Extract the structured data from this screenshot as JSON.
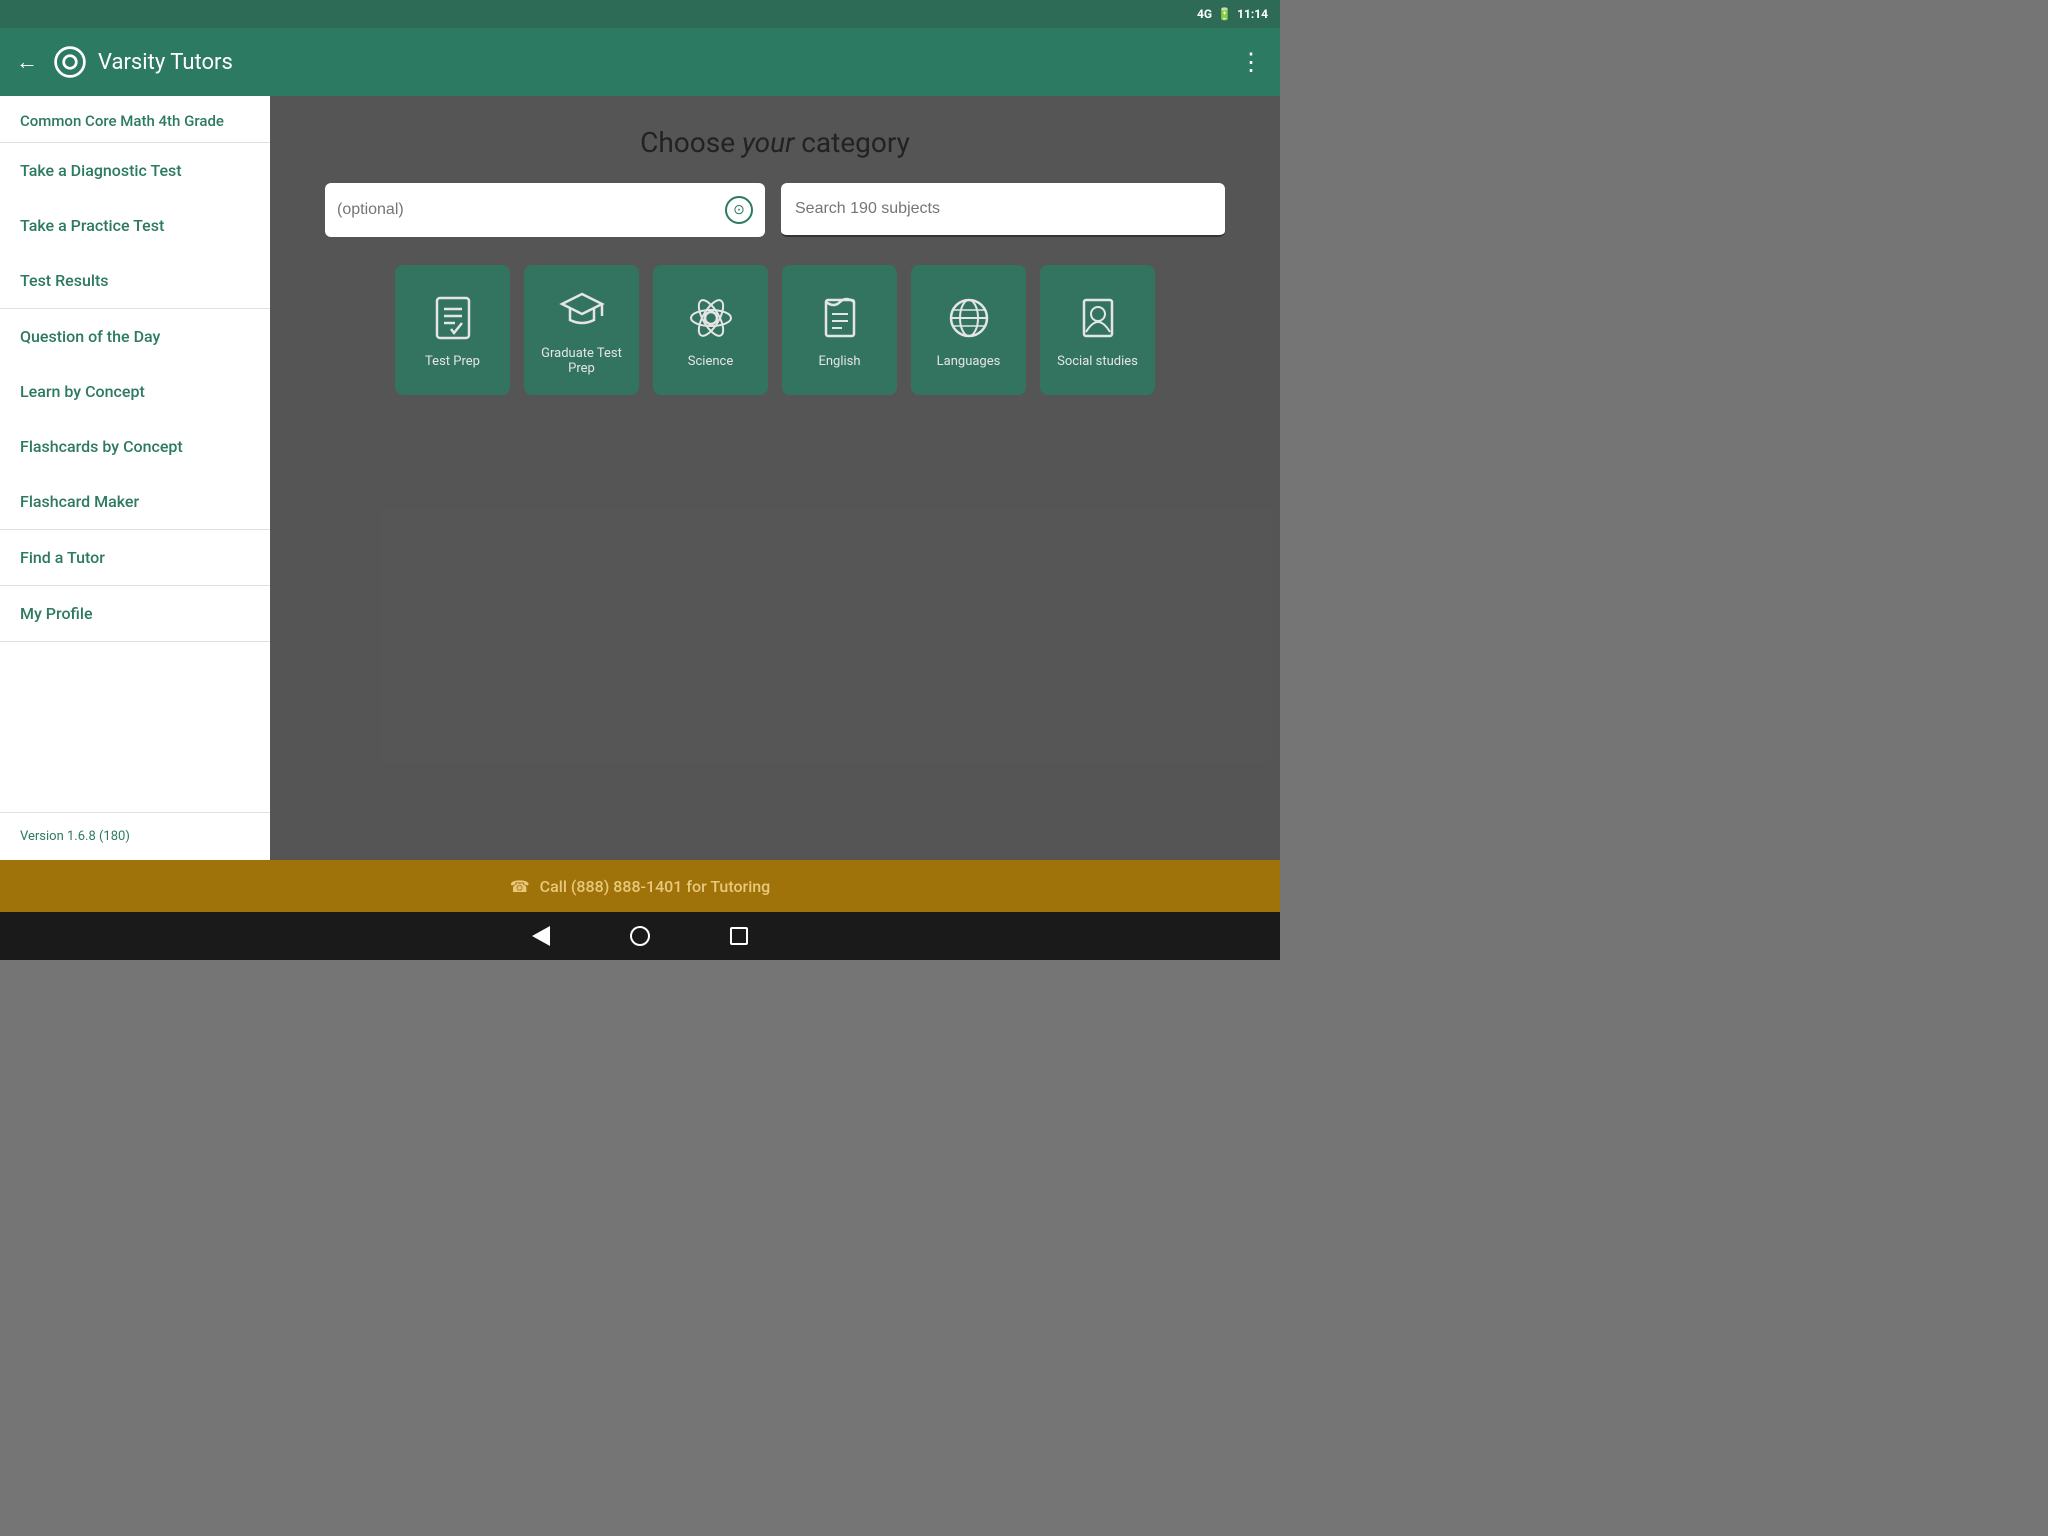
{
  "statusBar": {
    "signal": "4G",
    "time": "11:14"
  },
  "appBar": {
    "title": "Varsity Tutors",
    "backLabel": "←",
    "moreLabel": "⋮"
  },
  "sidebar": {
    "headerLabel": "Common Core Math 4th Grade",
    "items": [
      {
        "id": "diagnostic",
        "label": "Take a Diagnostic Test"
      },
      {
        "id": "practice",
        "label": "Take a Practice Test"
      },
      {
        "id": "results",
        "label": "Test Results"
      },
      {
        "id": "qotd",
        "label": "Question of the Day"
      },
      {
        "id": "learn",
        "label": "Learn by Concept"
      },
      {
        "id": "flashcards",
        "label": "Flashcards by Concept"
      },
      {
        "id": "maker",
        "label": "Flashcard Maker"
      },
      {
        "id": "tutor",
        "label": "Find a Tutor"
      },
      {
        "id": "profile",
        "label": "My Profile"
      }
    ],
    "versionLabel": "Version 1.6.8 (180)"
  },
  "main": {
    "title": "Choose",
    "titleItalic": "your",
    "titleSuffix": "category",
    "searchLeftPlaceholder": "(optional)",
    "searchRightPlaceholder": "Search 190 subjects"
  },
  "categories": [
    {
      "id": "test-prep",
      "label": "Test Prep",
      "icon": "test"
    },
    {
      "id": "graduate-test-prep",
      "label": "Graduate Test Prep",
      "icon": "graduate"
    },
    {
      "id": "science",
      "label": "Science",
      "icon": "science"
    },
    {
      "id": "english",
      "label": "English",
      "icon": "english"
    },
    {
      "id": "languages",
      "label": "Languages",
      "icon": "languages"
    },
    {
      "id": "social-studies",
      "label": "Social studies",
      "icon": "social"
    }
  ],
  "callBar": {
    "phoneIcon": "☎",
    "label": "Call (888) 888-1401 for Tutoring"
  }
}
